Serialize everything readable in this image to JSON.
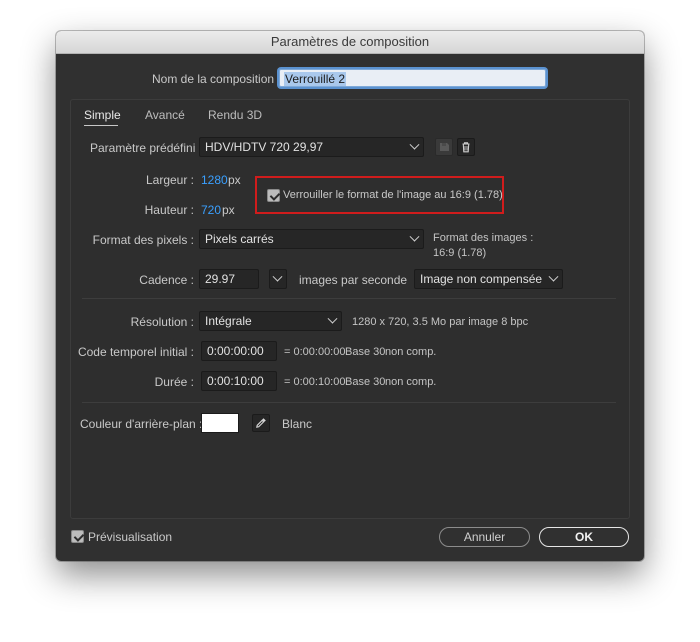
{
  "window": {
    "title": "Paramètres de composition"
  },
  "composition_name": {
    "label": "Nom de la composition :",
    "value": "Verrouillé 2"
  },
  "tabs": [
    {
      "label": "Simple",
      "active": true
    },
    {
      "label": "Avancé",
      "active": false
    },
    {
      "label": "Rendu 3D",
      "active": false
    }
  ],
  "preset": {
    "label": "Paramètre prédéfini :",
    "value": "HDV/HDTV 720 29,97"
  },
  "width": {
    "label": "Largeur :",
    "value": "1280",
    "unit": "px"
  },
  "height": {
    "label": "Hauteur :",
    "value": "720",
    "unit": "px"
  },
  "lock_aspect": {
    "label": "Verrouiller le format de l'image au 16:9 (1.78)",
    "checked": true
  },
  "pixel_aspect": {
    "label": "Format des pixels :",
    "value": "Pixels carrés"
  },
  "frame_aspect": {
    "label": "Format des images :",
    "value": "16:9 (1.78)"
  },
  "frame_rate": {
    "label": "Cadence :",
    "value": "29.97",
    "unit": "images par seconde",
    "drop_frame": "Image non compensée"
  },
  "resolution": {
    "label": "Résolution :",
    "value": "Intégrale",
    "info": "1280 x 720, 3.5 Mo par image 8 bpc"
  },
  "start_timecode": {
    "label": "Code temporel initial :",
    "value": "0:00:00:00",
    "equals": "= 0:00:00:00",
    "base": "Base 30",
    "comp": "non comp."
  },
  "duration": {
    "label": "Durée :",
    "value": "0:00:10:00",
    "equals": "= 0:00:10:00",
    "base": "Base 30",
    "comp": "non comp."
  },
  "background": {
    "label": "Couleur d'arrière-plan :",
    "color": "#ffffff",
    "name": "Blanc"
  },
  "preview": {
    "label": "Prévisualisation",
    "checked": true
  },
  "buttons": {
    "cancel": "Annuler",
    "ok": "OK"
  },
  "colors": {
    "accent": "#3aa0ff",
    "highlight_box": "#d01c1c",
    "dialog_bg": "#303030"
  },
  "icons": [
    "save-preset-icon",
    "trash-icon",
    "chevron-down-icon",
    "eyedropper-icon",
    "checkmark-icon"
  ]
}
